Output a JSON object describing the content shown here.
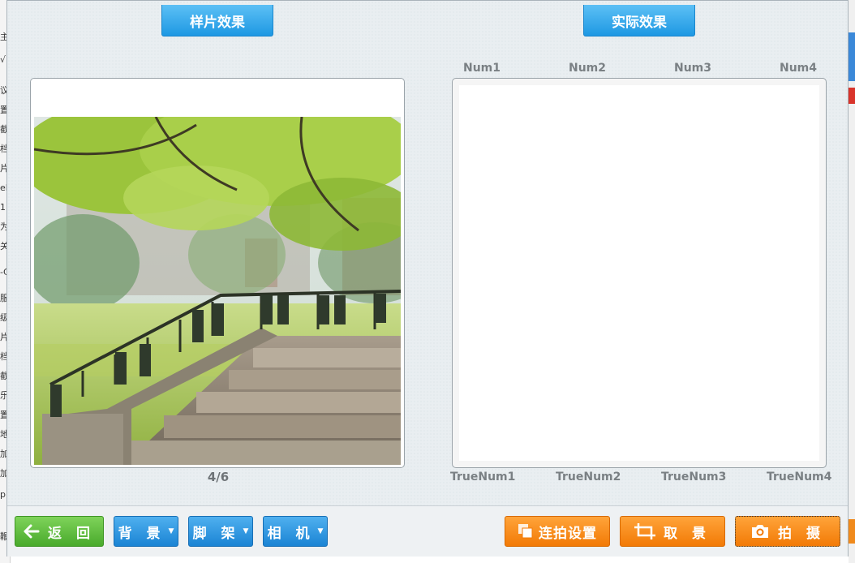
{
  "background_left_chars": [
    "主",
    "√",
    "议",
    "置",
    "截",
    "档",
    "片",
    "el",
    "1",
    "为",
    "关",
    "-C",
    "服",
    "级",
    "片",
    "档",
    "截",
    "乐",
    "置",
    "地",
    "加",
    "加",
    "p",
    "鞭"
  ],
  "tabs": {
    "sample": "样片效果",
    "actual": "实际效果"
  },
  "sample_panel": {
    "counter": "4/6",
    "photo": "park-stairs-photo"
  },
  "actual_panel": {
    "top_labels": [
      "Num1",
      "Num2",
      "Num3",
      "Num4"
    ],
    "bottom_labels": [
      "TrueNum1",
      "TrueNum2",
      "TrueNum3",
      "TrueNum4"
    ]
  },
  "toolbar": {
    "back_label": "返 回",
    "background_label": "背 景",
    "tripod_label": "脚 架",
    "camera_label": "相 机",
    "burst_settings_label": "连拍设置",
    "framing_label": "取 景",
    "shoot_label": "拍 摄"
  },
  "colors": {
    "tab_blue": "#1e98e3",
    "button_green": "#49aa2c",
    "button_blue": "#1b84d4",
    "button_orange": "#f27a06"
  },
  "icons": {
    "back": "arrow-left-icon",
    "dropdown": "caret-down-icon",
    "burst": "stacked-squares-icon",
    "framing": "crop-frame-icon",
    "shoot": "camera-icon"
  }
}
